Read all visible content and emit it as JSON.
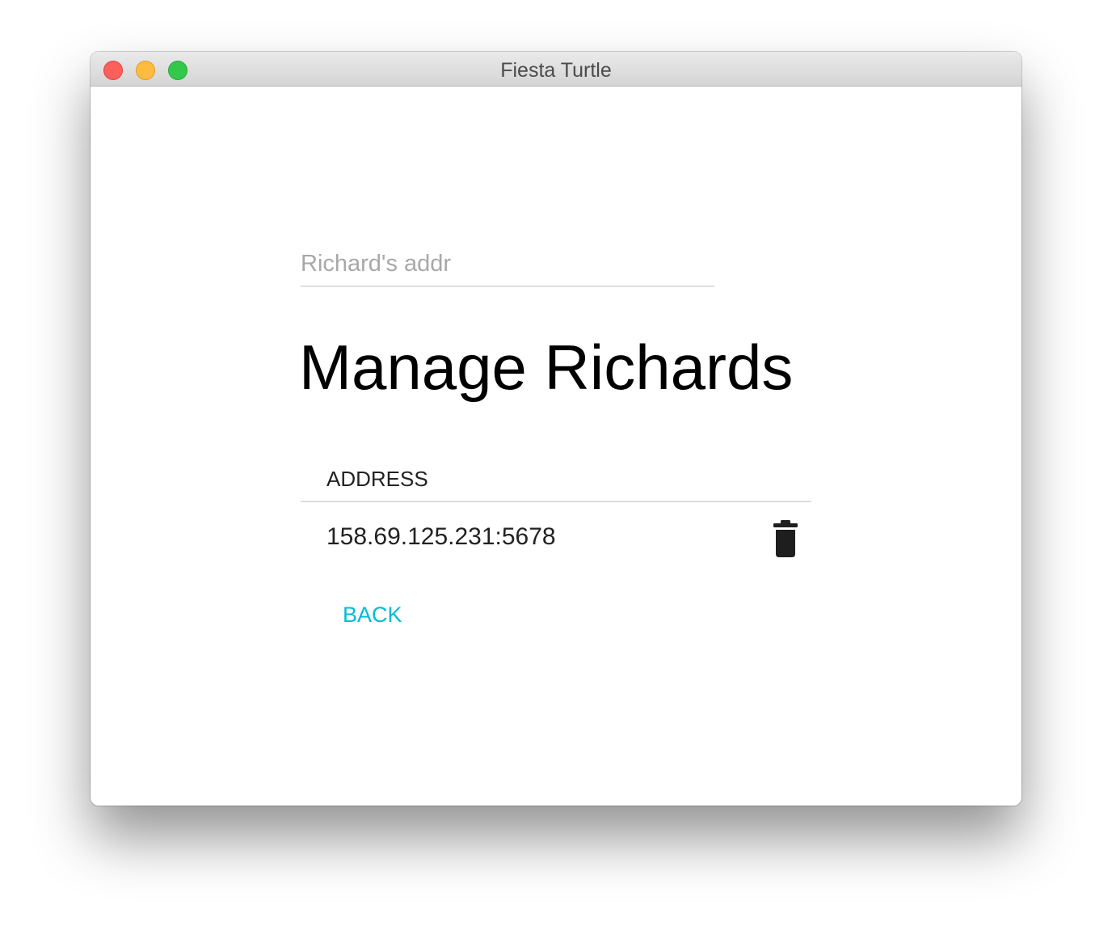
{
  "window": {
    "title": "Fiesta Turtle"
  },
  "form": {
    "address_value": "",
    "address_placeholder": "Richard's addr"
  },
  "page": {
    "title": "Manage Richards"
  },
  "table": {
    "columns": [
      "ADDRESS"
    ],
    "rows": [
      {
        "address": "158.69.125.231:5678",
        "action_icon": "trash-icon"
      }
    ]
  },
  "actions": {
    "back_label": "BACK"
  },
  "colors": {
    "accent": "#00bcd4",
    "close": "#fc605c",
    "minimize": "#fdbc40",
    "zoom": "#34c84a"
  }
}
